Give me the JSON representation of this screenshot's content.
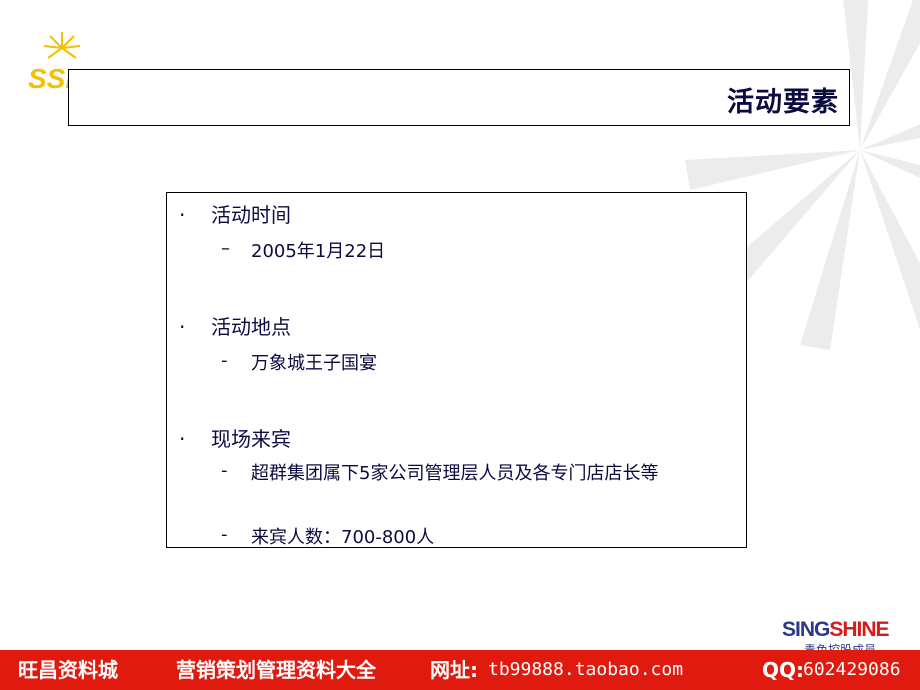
{
  "slide": {
    "title": "活动要素",
    "logo_text": "SSI"
  },
  "items": [
    {
      "bullet": "·",
      "label": "活动时间",
      "subs": [
        {
          "dash": "–",
          "text": "2005年1月22日"
        }
      ]
    },
    {
      "bullet": "·",
      "label": "活动地点",
      "subs": [
        {
          "dash": "-",
          "text": "万象城王子国宴"
        }
      ]
    },
    {
      "bullet": "·",
      "label": "现场来宾",
      "subs": [
        {
          "dash": "-",
          "text": "超群集团属下5家公司管理层人员及各专门店店长等"
        },
        {
          "dash": "-",
          "text": "来宾人数：700-800人"
        }
      ]
    }
  ],
  "brand": {
    "sing": "SING",
    "shine": "SHINE",
    "sub": "青色控股成员"
  },
  "footer": {
    "left": "旺昌资料城",
    "mid": "营销策划管理资料大全",
    "site_label": "网址:",
    "site": "tb99888.taobao.com",
    "qq_label": "QQ:",
    "qq": "602429086"
  },
  "colors": {
    "text": "#0b0b40",
    "footer_bg": "#e01a0f",
    "logo_yellow": "#f2c200"
  }
}
